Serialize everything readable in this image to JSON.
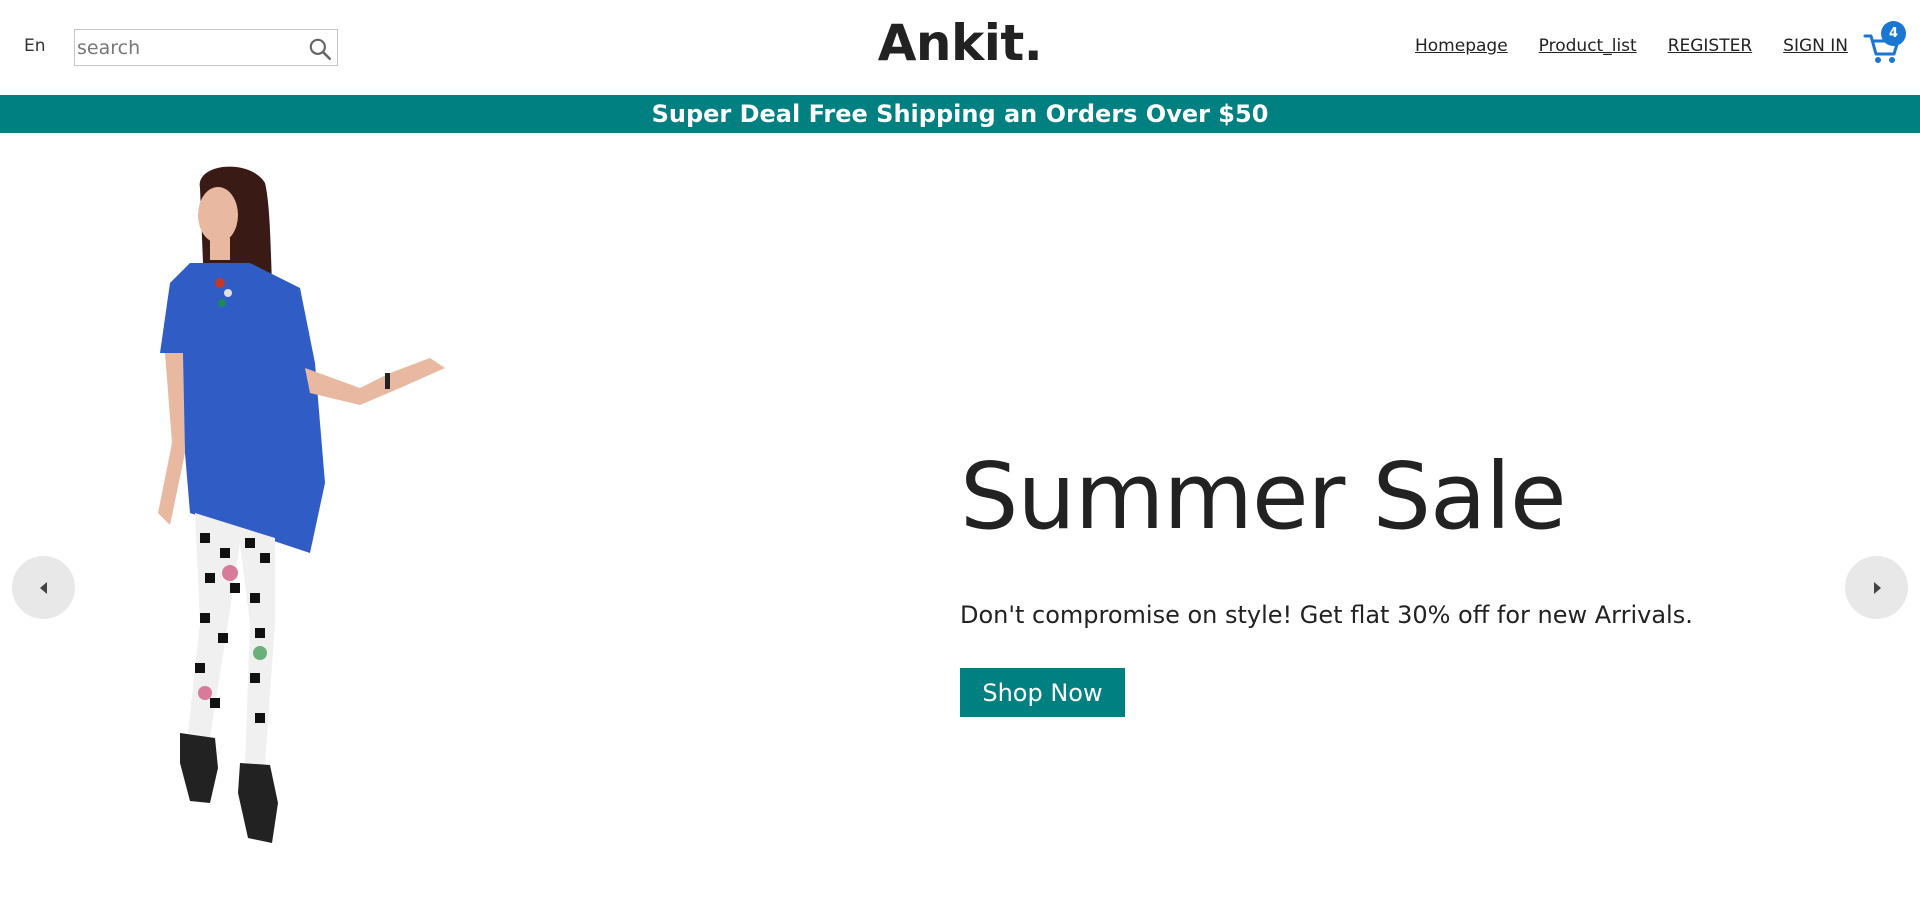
{
  "nav": {
    "language": "En",
    "search_placeholder": "search",
    "logo": "Ankit.",
    "links": [
      "Homepage",
      "Product_list",
      "REGISTER",
      "SIGN IN"
    ],
    "cart_count": "4"
  },
  "announcement": "Super Deal Free Shipping an Orders Over $50",
  "slide": {
    "title": "Summer Sale",
    "description": "Don't compromise on style! Get flat 30% off for new Arrivals.",
    "button": "Shop Now"
  },
  "colors": {
    "accent": "#008080",
    "badge": "#1976d2"
  }
}
